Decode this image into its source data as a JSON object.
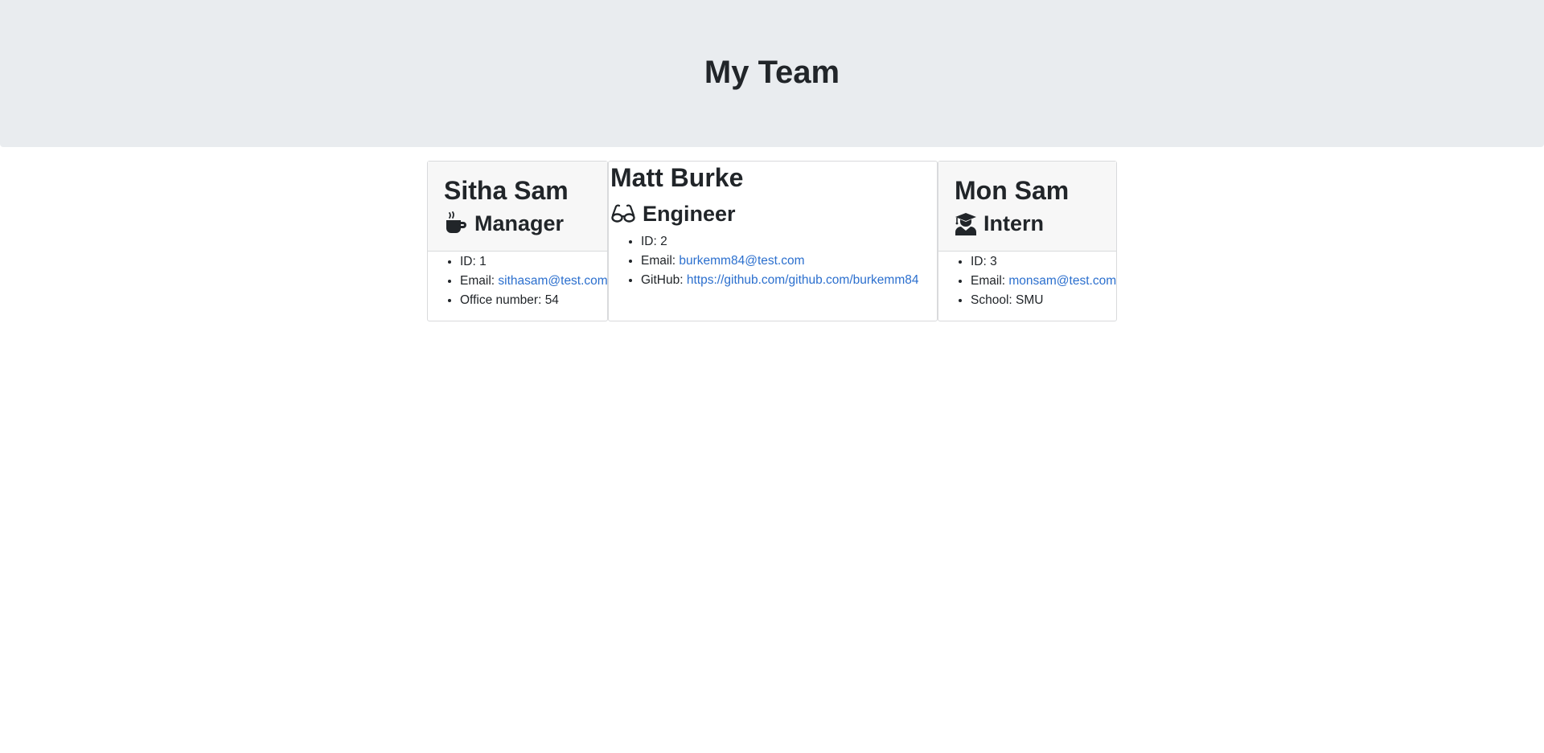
{
  "page": {
    "title": "My Team"
  },
  "members": [
    {
      "name": "Sitha Sam",
      "role": "Manager",
      "role_icon": "coffee-icon",
      "details": [
        {
          "label": "ID: ",
          "value": "1"
        },
        {
          "label": "Email: ",
          "value": "sithasam@test.com"
        },
        {
          "label": "Office number: ",
          "value": "54"
        }
      ]
    },
    {
      "name": "Matt Burke",
      "role": "Engineer",
      "role_icon": "glasses-icon",
      "details": [
        {
          "label": "ID: ",
          "value": "2"
        },
        {
          "label": "Email: ",
          "value": "burkemm84@test.com"
        },
        {
          "label": "GitHub: ",
          "value": "https://github.com/github.com/burkemm84"
        }
      ]
    },
    {
      "name": "Mon Sam",
      "role": "Intern",
      "role_icon": "graduate-icon",
      "details": [
        {
          "label": "ID: ",
          "value": "3"
        },
        {
          "label": "Email: ",
          "value": "monsam@test.com"
        },
        {
          "label": "School: ",
          "value": "SMU"
        }
      ]
    }
  ]
}
